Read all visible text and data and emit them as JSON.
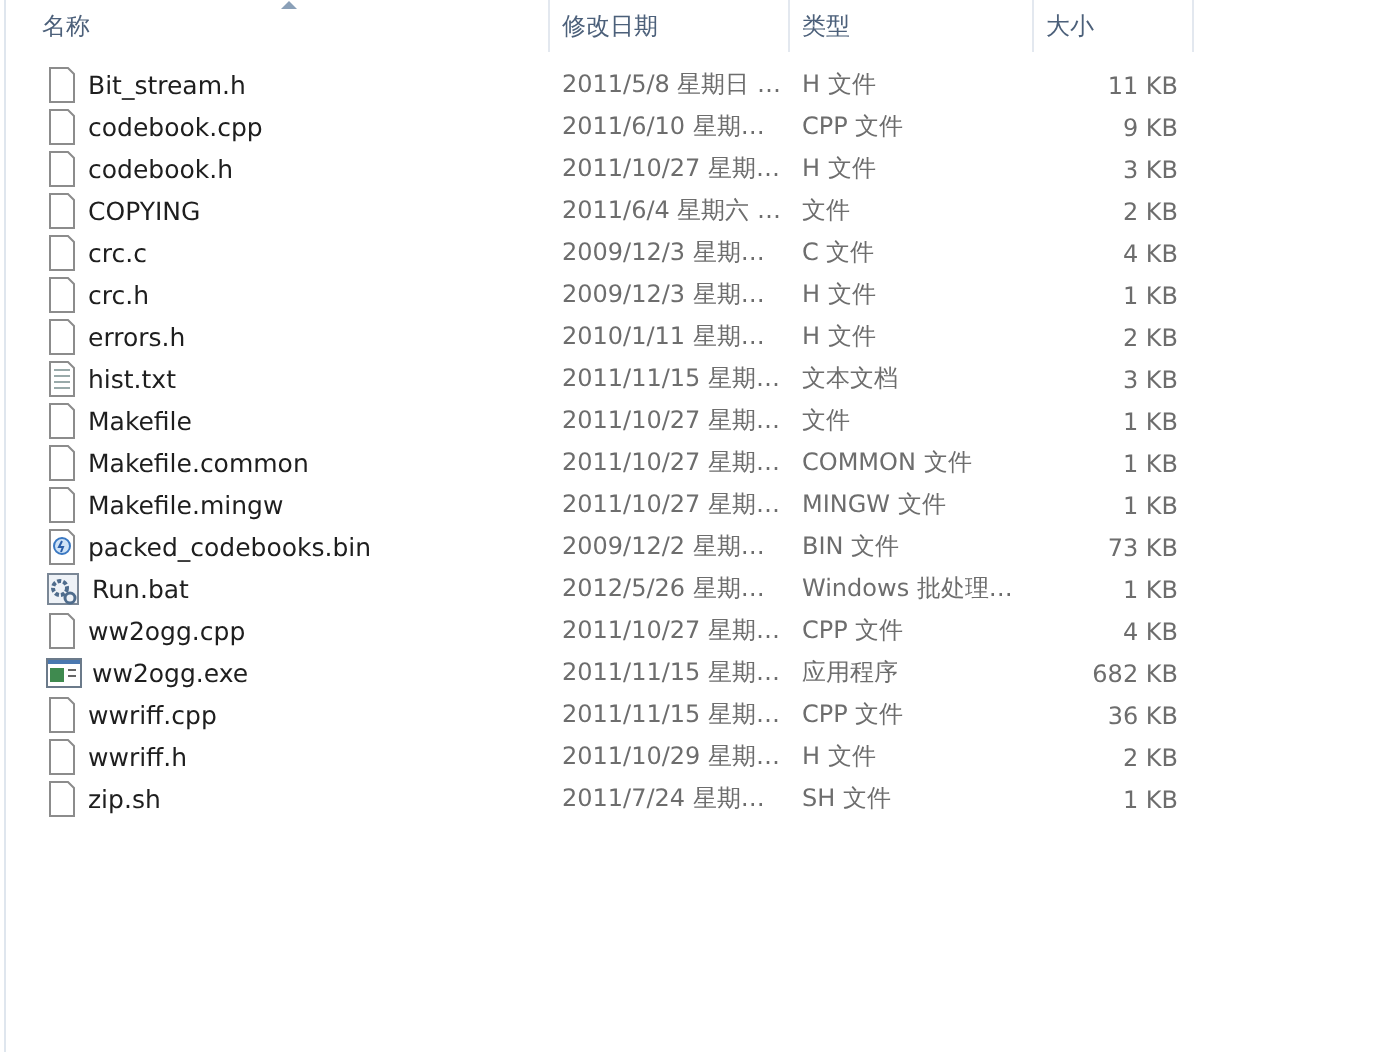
{
  "columns": [
    {
      "label": "名称",
      "sorted": true
    },
    {
      "label": "修改日期",
      "sorted": false
    },
    {
      "label": "类型",
      "sorted": false
    },
    {
      "label": "大小",
      "sorted": false
    }
  ],
  "files": [
    {
      "name": "Bit_stream.h",
      "kind": "file",
      "date": "2011/5/8 星期日 …",
      "type": "H 文件",
      "size": "11 KB"
    },
    {
      "name": "codebook.cpp",
      "kind": "file",
      "date": "2011/6/10 星期…",
      "type": "CPP 文件",
      "size": "9 KB"
    },
    {
      "name": "codebook.h",
      "kind": "file",
      "date": "2011/10/27 星期…",
      "type": "H 文件",
      "size": "3 KB"
    },
    {
      "name": "COPYING",
      "kind": "file",
      "date": "2011/6/4 星期六 …",
      "type": "文件",
      "size": "2 KB"
    },
    {
      "name": "crc.c",
      "kind": "file",
      "date": "2009/12/3 星期…",
      "type": "C 文件",
      "size": "4 KB"
    },
    {
      "name": "crc.h",
      "kind": "file",
      "date": "2009/12/3 星期…",
      "type": "H 文件",
      "size": "1 KB"
    },
    {
      "name": "errors.h",
      "kind": "file",
      "date": "2010/1/11 星期…",
      "type": "H 文件",
      "size": "2 KB"
    },
    {
      "name": "hist.txt",
      "kind": "text",
      "date": "2011/11/15 星期…",
      "type": "文本文档",
      "size": "3 KB"
    },
    {
      "name": "Makefile",
      "kind": "file",
      "date": "2011/10/27 星期…",
      "type": "文件",
      "size": "1 KB"
    },
    {
      "name": "Makefile.common",
      "kind": "file",
      "date": "2011/10/27 星期…",
      "type": "COMMON 文件",
      "size": "1 KB"
    },
    {
      "name": "Makefile.mingw",
      "kind": "file",
      "date": "2011/10/27 星期…",
      "type": "MINGW 文件",
      "size": "1 KB"
    },
    {
      "name": "packed_codebooks.bin",
      "kind": "bin",
      "date": "2009/12/2 星期…",
      "type": "BIN 文件",
      "size": "73 KB"
    },
    {
      "name": "Run.bat",
      "kind": "bat",
      "date": "2012/5/26 星期…",
      "type": "Windows 批处理…",
      "size": "1 KB"
    },
    {
      "name": "ww2ogg.cpp",
      "kind": "file",
      "date": "2011/10/27 星期…",
      "type": "CPP 文件",
      "size": "4 KB"
    },
    {
      "name": "ww2ogg.exe",
      "kind": "exe",
      "date": "2011/11/15 星期…",
      "type": "应用程序",
      "size": "682 KB"
    },
    {
      "name": "wwriff.cpp",
      "kind": "file",
      "date": "2011/11/15 星期…",
      "type": "CPP 文件",
      "size": "36 KB"
    },
    {
      "name": "wwriff.h",
      "kind": "file",
      "date": "2011/10/29 星期…",
      "type": "H 文件",
      "size": "2 KB"
    },
    {
      "name": "zip.sh",
      "kind": "file",
      "date": "2011/7/24 星期…",
      "type": "SH 文件",
      "size": "1 KB"
    }
  ]
}
